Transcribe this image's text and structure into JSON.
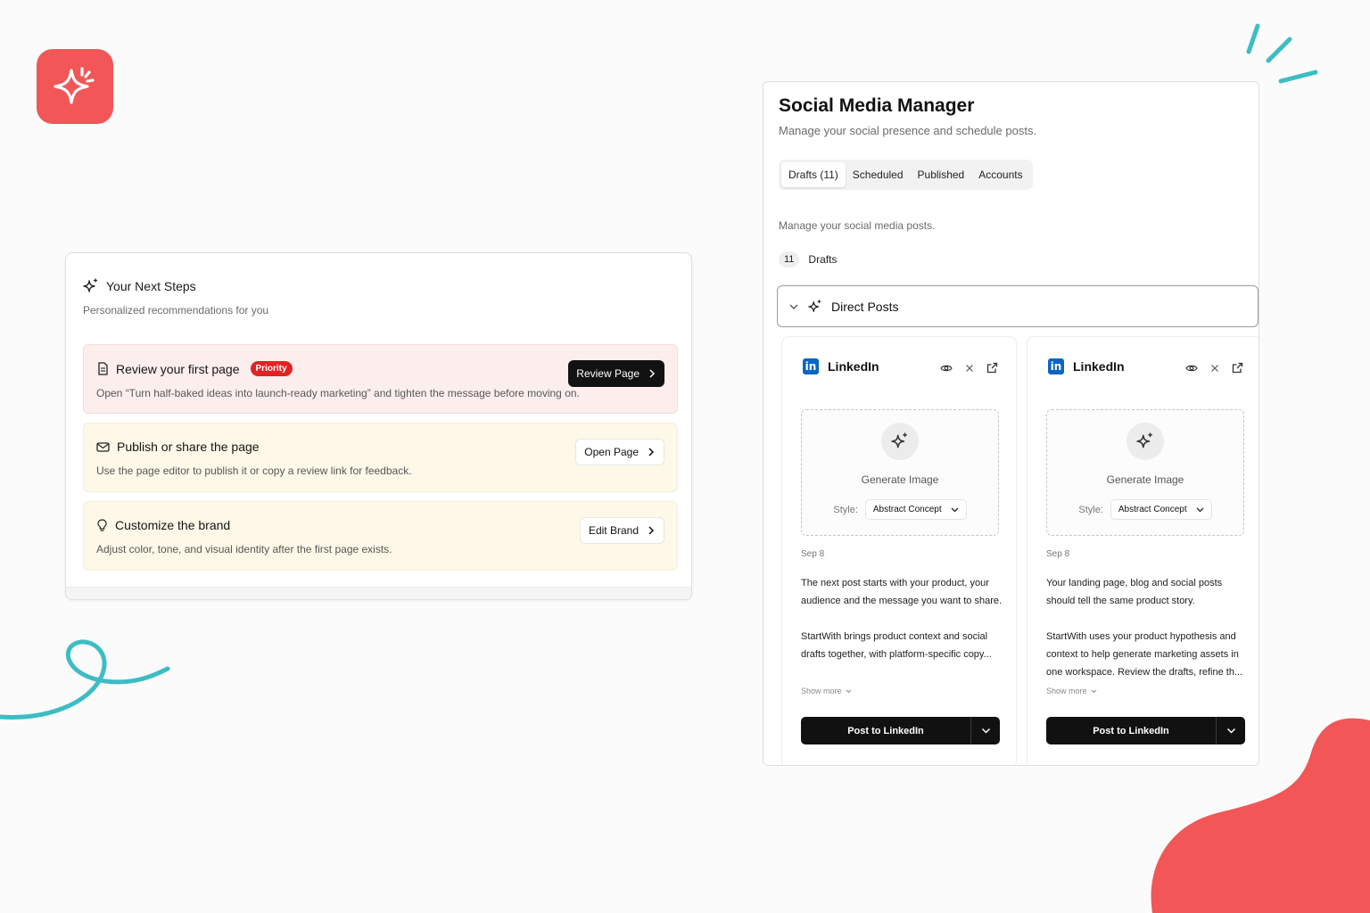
{
  "colors": {
    "brand": "#f25656",
    "accent_teal": "#3dbdc3",
    "priority": "#e22222",
    "linkedin": "#0a66c2"
  },
  "next_steps": {
    "title": "Your Next Steps",
    "subtitle": "Personalized recommendations for you",
    "items": [
      {
        "icon": "document-icon",
        "title": "Review your first page",
        "badge": "Priority",
        "description": "Open “Turn half-baked ideas into launch-ready marketing” and tighten the message before moving on.",
        "button": "Review Page"
      },
      {
        "icon": "mail-icon",
        "title": "Publish or share the page",
        "description": "Use the page editor to publish it or copy a review link for feedback.",
        "button": "Open Page"
      },
      {
        "icon": "lightbulb-icon",
        "title": "Customize the brand",
        "description": "Adjust color, tone, and visual identity after the first page exists.",
        "button": "Edit Brand"
      }
    ]
  },
  "smm": {
    "title": "Social Media Manager",
    "subtitle": "Manage your social presence and schedule posts.",
    "tabs": [
      "Drafts (11)",
      "Scheduled",
      "Published",
      "Accounts"
    ],
    "active_tab": "Drafts (11)",
    "note": "Manage your social media posts.",
    "drafts_count": "11",
    "drafts_label": "Drafts",
    "section": "Direct Posts",
    "posts": [
      {
        "platform": "LinkedIn",
        "generate_label": "Generate Image",
        "style_label": "Style:",
        "style_value": "Abstract Concept",
        "date": "Sep 8",
        "body_1": "The next post starts with your product, your audience and the message you want to share.",
        "body_2": "StartWith brings product context and social drafts together, with platform-specific copy...",
        "show_more": "Show more",
        "button": "Post to LinkedIn"
      },
      {
        "platform": "LinkedIn",
        "generate_label": "Generate Image",
        "style_label": "Style:",
        "style_value": "Abstract Concept",
        "date": "Sep 8",
        "body_1": "Your landing page, blog and social posts should tell the same product story.",
        "body_2": "StartWith uses your product hypothesis and context to help generate marketing assets in one workspace. Review the drafts, refine th...",
        "show_more": "Show more",
        "button": "Post to LinkedIn"
      }
    ]
  }
}
